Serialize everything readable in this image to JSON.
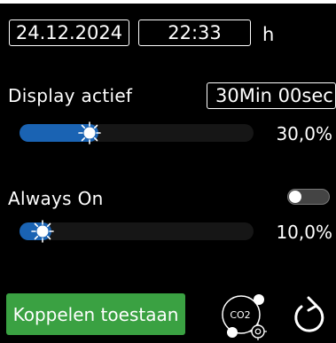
{
  "datetime": {
    "date": "24.12.2024",
    "time": "22:33",
    "unit": "h"
  },
  "display": {
    "label": "Display actief",
    "timeout": "30Min 00sec",
    "brightness_value": "30,0%",
    "brightness_fraction": 0.3
  },
  "always_on": {
    "label": "Always On",
    "toggle_state": "off",
    "brightness_value": "10,0%",
    "brightness_fraction": 0.1
  },
  "actions": {
    "pair_label": "Koppelen toestaan",
    "co2_text": "CO2"
  },
  "colors": {
    "accent": "#1a63b3",
    "button_green": "#3aa142",
    "background": "#000000"
  },
  "icons": {
    "co2": "co2-sensor-icon",
    "refresh": "refresh-icon",
    "slider_knob": "sun-knob-icon"
  }
}
